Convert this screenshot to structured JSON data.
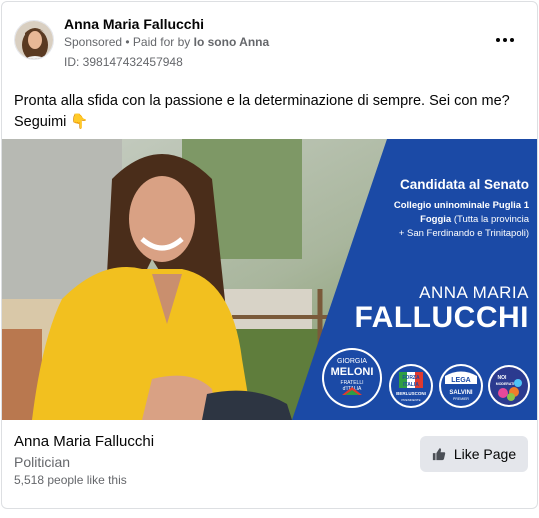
{
  "post": {
    "page_name": "Anna Maria Fallucchi",
    "sponsored_label": "Sponsored",
    "separator": " • ",
    "paid_for_prefix": "Paid for by ",
    "payer": "Io sono Anna",
    "ad_id": "ID: 398147432457948",
    "more_icon": "ellipsis-icon",
    "message": "Pronta alla sfida con la passione e la determinazione di sempre. Sei con me? Seguimi 👇"
  },
  "creative": {
    "headline": "Candidata al Senato",
    "line2": "Collegio uninominale Puglia 1",
    "line3_bold": "Foggia",
    "line3_rest": " (Tutta la provincia",
    "line4": "+ San Ferdinando e Trinitapoli)",
    "first_name": "ANNA MARIA",
    "last_name": "FALLUCCHI",
    "panel_color": "#1b4aa6",
    "logos": {
      "fdi_top": "GIORGIA",
      "fdi_name": "MELONI",
      "fdi_sub1": "FRATELLI",
      "fdi_sub2": "d'ITALIA",
      "fi_top": "FORZA",
      "fi_mid": "ITALIA",
      "fi_name": "BERLUSCONI",
      "fi_sub": "PRESIDENTE",
      "lega_name": "LEGA",
      "lega_leader": "SALVINI",
      "lega_sub": "PREMIER",
      "nm_top": "NOI",
      "nm_mid": "MODERATI"
    }
  },
  "footer": {
    "page_title": "Anna Maria Fallucchi",
    "category": "Politician",
    "likes": "5,518 people like this",
    "like_button_label": "Like Page",
    "like_icon": "thumbs-up-icon"
  }
}
